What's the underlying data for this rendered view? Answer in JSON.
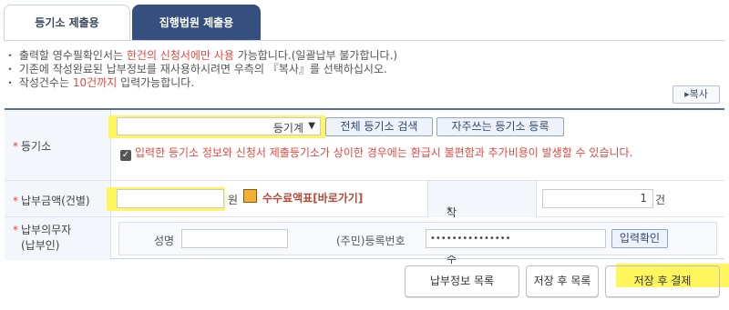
{
  "tabs": [
    {
      "label": "등기소 제출용",
      "active": true
    },
    {
      "label": "집행법원 제출용",
      "active": false
    }
  ],
  "notes": {
    "line1_pre": "・ 출력할 영수필확인서는 ",
    "line1_hl": "한건의 신청서에만 사용",
    "line1_post": " 가능합니다.(일괄납부 불가합니다.)",
    "line2": "・ 기존에 작성완료된 납부정보를 재사용하시려면 우측의 『복사』를 선택하십시오.",
    "line3_pre": "・ 작성건수는 ",
    "line3_hl": "10건까지",
    "line3_post": " 입력가능합니다."
  },
  "copy_button": "▸복사",
  "registry": {
    "label": "등기소",
    "select_value": "등기계",
    "search_all_button": "전체 등기소 검색",
    "register_frequent_button": "자주쓰는 등기소 등록",
    "warning": "입력한 등기소 정보와 신청서 제출등기소가 상이한 경우에는 환급시 불편함과 추가비용이 발생할 수 있습니다."
  },
  "payment": {
    "label": "납부금액(건별)",
    "unit": "원",
    "fee_link": "수수료액표[바로가기]",
    "count_label": "작성건수",
    "count_value": "1",
    "count_unit": "건"
  },
  "payer": {
    "label_line1": "납부의무자",
    "label_line2": "(납부인)",
    "name_label": "성명",
    "id_label": "(주민)등록번호",
    "id_value": "•••••••••••••••",
    "confirm_button": "입력확인"
  },
  "actions": {
    "list_button": "납부정보 목록",
    "save_list_button": "저장 후 목록",
    "save_pay_button": "저장 후 결제"
  },
  "colors": {
    "accent": "#354f7e",
    "warning": "#e4493f",
    "highlight": "#fff55c"
  }
}
